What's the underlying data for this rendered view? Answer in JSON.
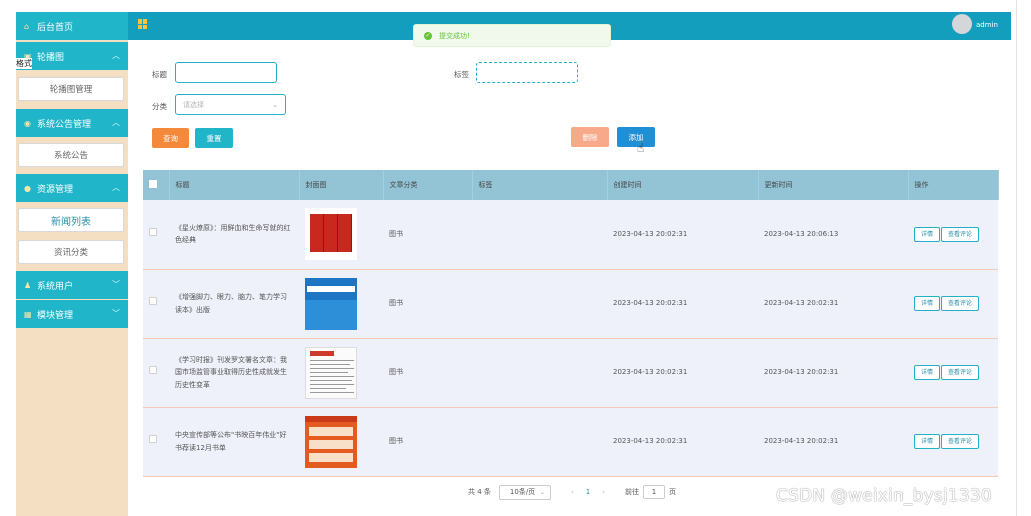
{
  "sidebar": {
    "items": [
      {
        "label": "后台首页",
        "icon": "home-icon",
        "expanded": false
      },
      {
        "label": "轮播图",
        "icon": "image-icon",
        "expanded": true,
        "children": [
          "轮播图管理"
        ]
      },
      {
        "label": "系统公告管理",
        "icon": "bell-icon",
        "expanded": true,
        "children": [
          "系统公告"
        ]
      },
      {
        "label": "资源管理",
        "icon": "resource-icon",
        "expanded": true,
        "children": [
          "新闻列表",
          "资讯分类"
        ]
      },
      {
        "label": "系统用户",
        "icon": "user-icon",
        "expanded": false
      },
      {
        "label": "模块管理",
        "icon": "module-icon",
        "expanded": false
      }
    ],
    "stray_text": "格式"
  },
  "topbar": {
    "username": "admin",
    "icon": "grid-menu-icon"
  },
  "toast": {
    "message": "提交成功!",
    "icon": "check-circle-icon"
  },
  "filters": {
    "title_label": "标题",
    "tag_label": "标签",
    "category_label": "分类",
    "category_placeholder": "请选择"
  },
  "buttons": {
    "search": "查询",
    "reset": "重置",
    "delete": "删除",
    "add": "添加"
  },
  "table": {
    "headers": [
      "标题",
      "封面图",
      "文章分类",
      "标签",
      "创建时间",
      "更新时间",
      "操作"
    ],
    "rows": [
      {
        "title": "《星火燎原》：用鲜血和生命写就的红色经典",
        "category": "图书",
        "tag": "",
        "created": "2023-04-13 20:02:31",
        "updated": "2023-04-13 20:06:13"
      },
      {
        "title": "《增强脚力、眼力、脑力、笔力学习读本》出版",
        "category": "图书",
        "tag": "",
        "created": "2023-04-13 20:02:31",
        "updated": "2023-04-13 20:02:31"
      },
      {
        "title": "《学习时报》刊发罗文署名文章：我国市场监管事业取得历史性成就发生历史性变革",
        "category": "图书",
        "tag": "",
        "created": "2023-04-13 20:02:31",
        "updated": "2023-04-13 20:02:31"
      },
      {
        "title": "中央宣传部等公布\"书映百年伟业\"好书荐读12月书单",
        "category": "图书",
        "tag": "",
        "created": "2023-04-13 20:02:31",
        "updated": "2023-04-13 20:02:31"
      }
    ],
    "action_detail": "详情",
    "action_comments": "查看评论"
  },
  "pagination": {
    "total": "共 4 条",
    "page_size": "10条/页",
    "current_page": "1",
    "goto_prefix": "前往",
    "goto_value": "1",
    "goto_suffix": "页"
  },
  "watermark": "CSDN @weixin_bysj1330",
  "colors": {
    "primary": "#129ebc",
    "menu": "#21b5c9",
    "sidebar_bg": "#f5dfc3",
    "search_button": "#f5893b",
    "delete_button": "#f7a98a",
    "add_button": "#1f8fd6",
    "success": "#67c23a"
  }
}
